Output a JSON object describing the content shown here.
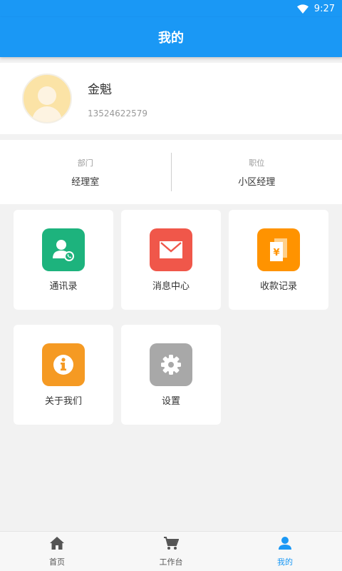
{
  "status_bar": {
    "time": "9:27"
  },
  "header": {
    "title": "我的"
  },
  "profile": {
    "name": "金魁",
    "phone": "13524622579"
  },
  "info": {
    "department_label": "部门",
    "department_value": "经理室",
    "position_label": "职位",
    "position_value": "小区经理"
  },
  "tiles": [
    {
      "label": "通讯录",
      "icon": "contacts-icon",
      "color": "#1db37d"
    },
    {
      "label": "消息中心",
      "icon": "mail-icon",
      "color": "#f0574a"
    },
    {
      "label": "收款记录",
      "icon": "payment-record-icon",
      "color": "#ff9300"
    },
    {
      "label": "关于我们",
      "icon": "info-icon",
      "color": "#f59a23"
    },
    {
      "label": "设置",
      "icon": "gear-icon",
      "color": "#a8a8a8"
    }
  ],
  "tabbar": {
    "items": [
      {
        "label": "首页",
        "icon": "home-icon"
      },
      {
        "label": "工作台",
        "icon": "cart-icon"
      },
      {
        "label": "我的",
        "icon": "person-icon",
        "active": true
      }
    ]
  },
  "colors": {
    "primary": "#1a98f5"
  }
}
